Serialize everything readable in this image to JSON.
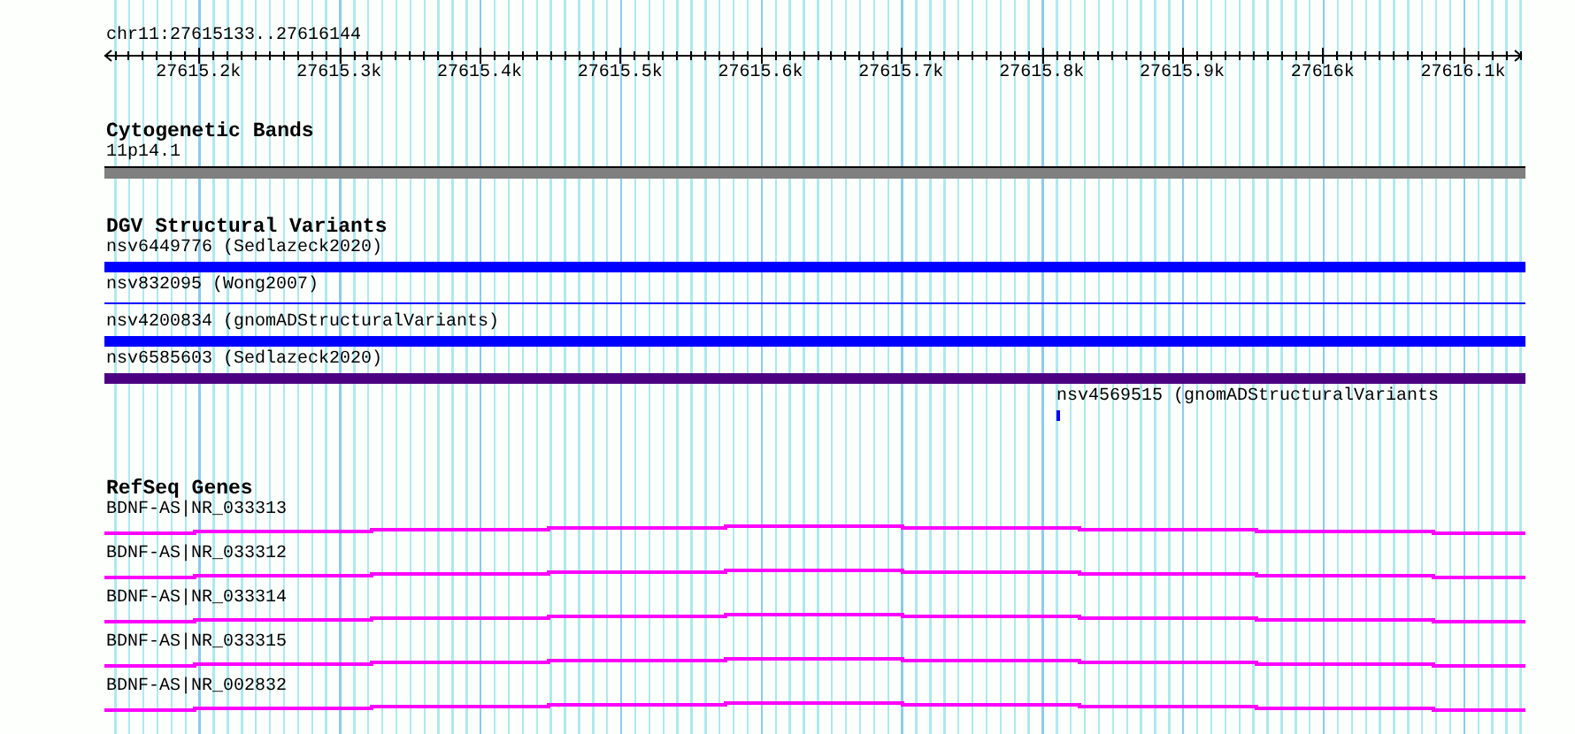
{
  "ruler": {
    "location": "chr11:27615133..27616144",
    "ticks": [
      "27615.2k",
      "27615.3k",
      "27615.4k",
      "27615.5k",
      "27615.6k",
      "27615.7k",
      "27615.8k",
      "27615.9k",
      "27616k",
      "27616.1k"
    ]
  },
  "cytogenetic_bands": {
    "title": "Cytogenetic Bands",
    "features": [
      {
        "label": "11p14.1"
      }
    ]
  },
  "dgv_structural_variants": {
    "title": "DGV Structural Variants",
    "features": [
      {
        "label": "nsv6449776 (Sedlazeck2020)",
        "kind": "thick",
        "color": "#0000ff"
      },
      {
        "label": "nsv832095 (Wong2007)",
        "kind": "thin",
        "color": "#0000ff"
      },
      {
        "label": "nsv4200834 (gnomADStructuralVariants)",
        "kind": "thick",
        "color": "#0000ff"
      },
      {
        "label": "nsv6585603 (Sedlazeck2020)",
        "kind": "thick",
        "color": "#4b0082"
      },
      {
        "label": "nsv4569515 (gnomADStructuralVariants",
        "kind": "point",
        "color": "#0000ff"
      }
    ]
  },
  "refseq_genes": {
    "title": "RefSeq Genes",
    "features": [
      {
        "label": "BDNF-AS|NR_033313"
      },
      {
        "label": "BDNF-AS|NR_033312"
      },
      {
        "label": "BDNF-AS|NR_033314"
      },
      {
        "label": "BDNF-AS|NR_033315"
      },
      {
        "label": "BDNF-AS|NR_002832"
      }
    ]
  }
}
